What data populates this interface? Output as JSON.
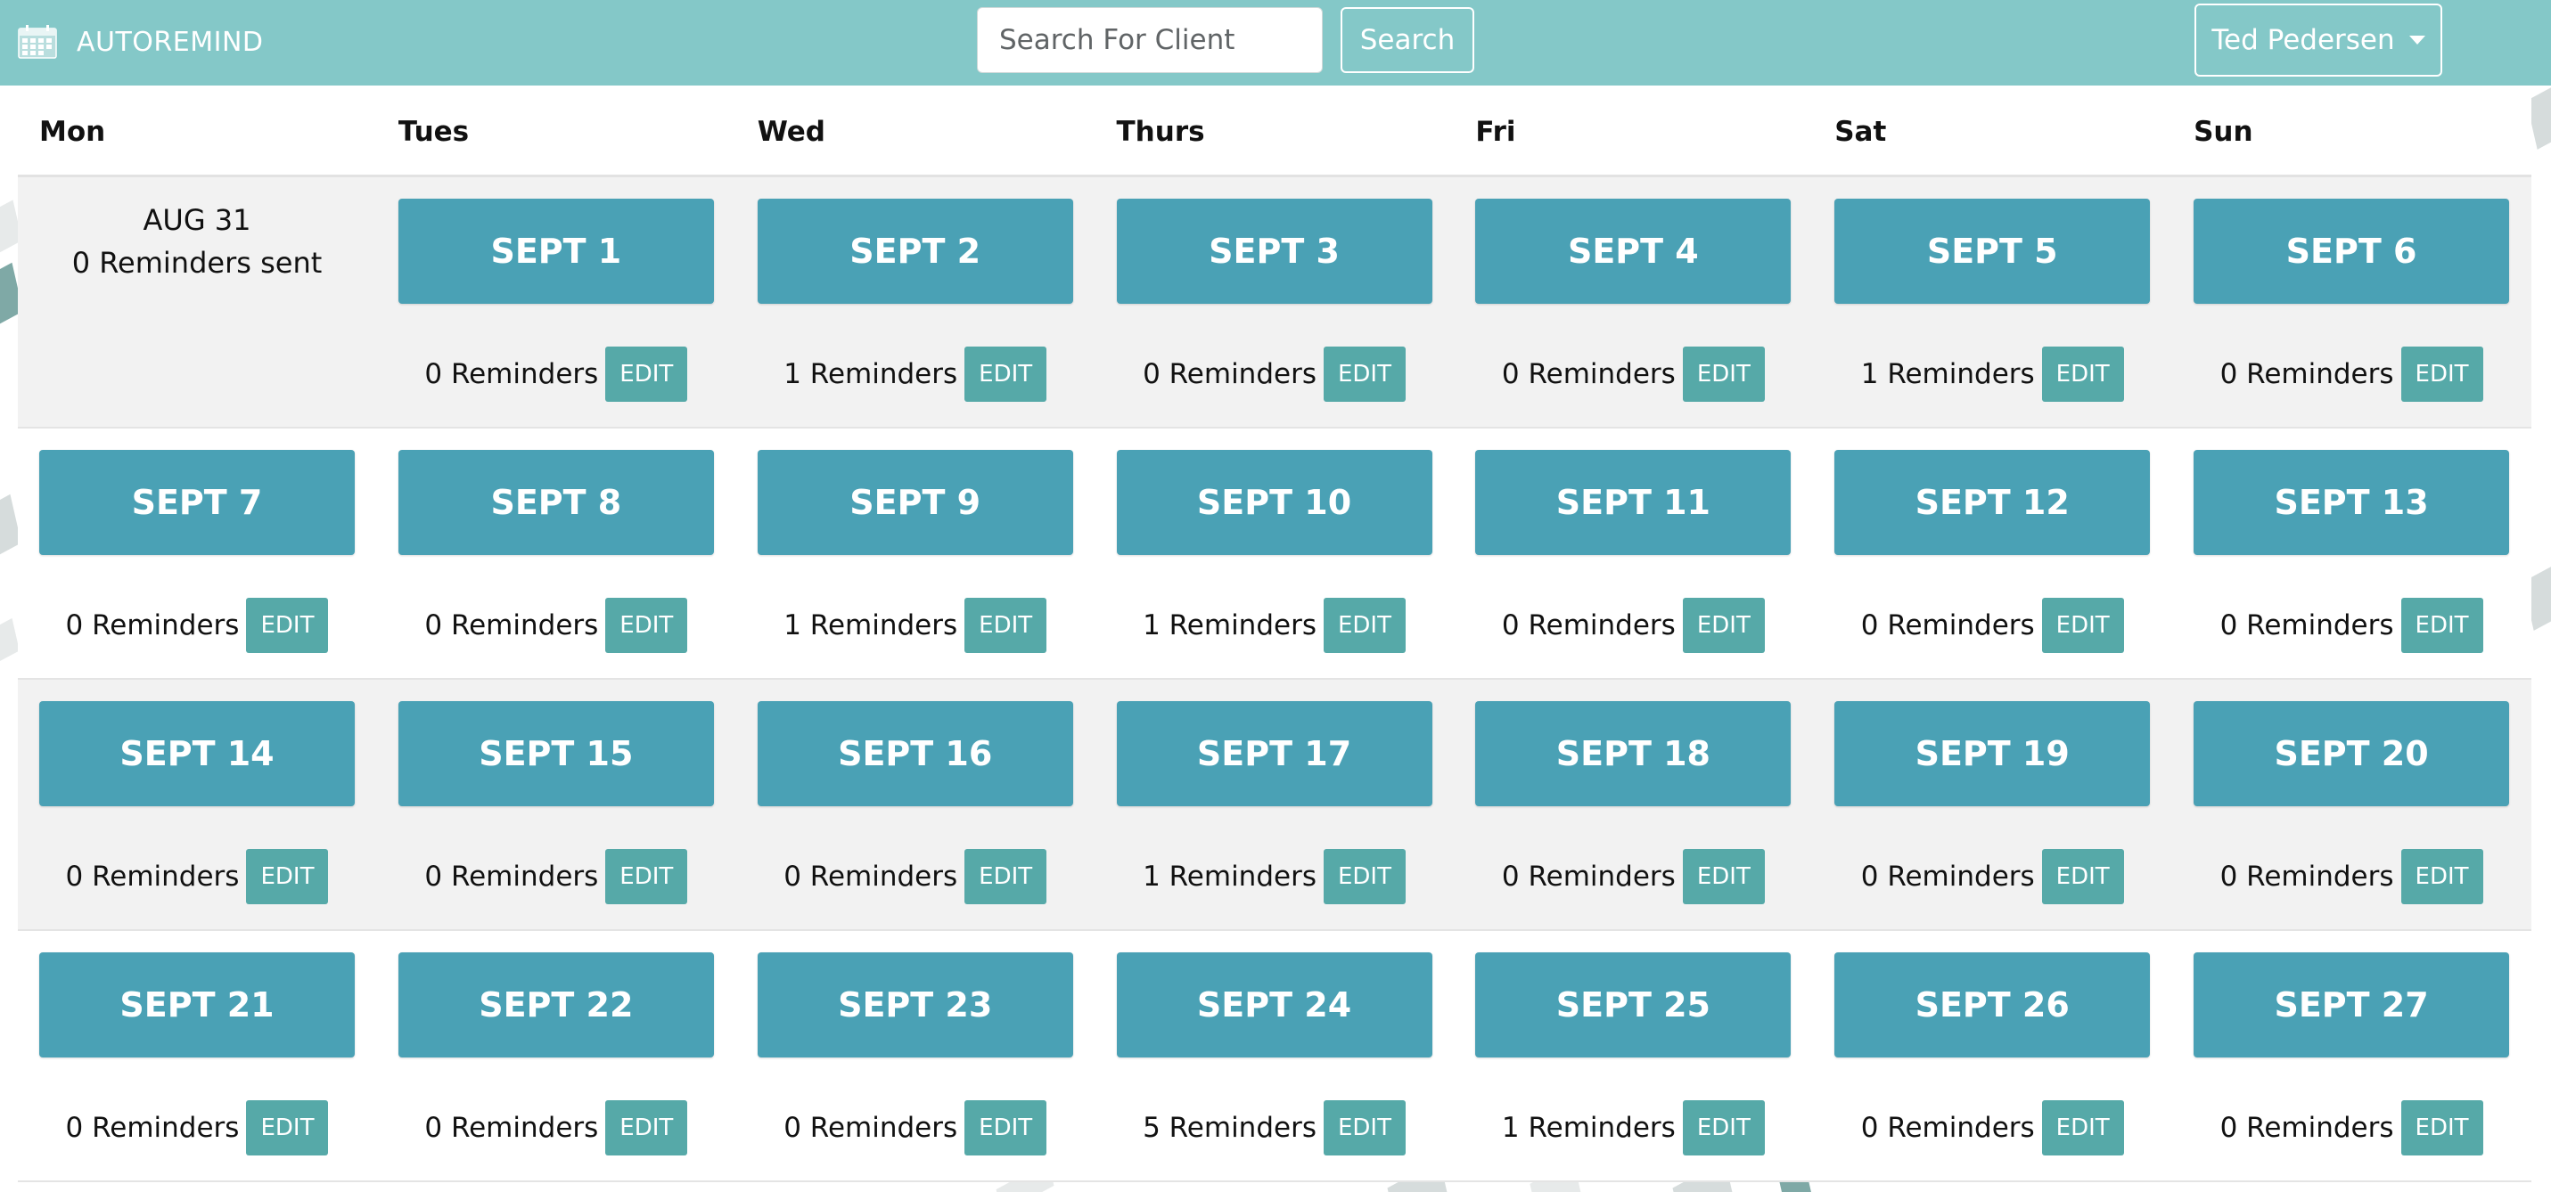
{
  "app": {
    "brand": "AUTOREMIND",
    "brand_icon": "calendar-icon"
  },
  "search": {
    "placeholder": "Search For Client",
    "button_label": "Search"
  },
  "user_menu": {
    "label": "Ted Pedersen",
    "icon": "chevron-down-icon"
  },
  "colors": {
    "topbar": "#84c8c8",
    "date_button": "#4aa1b5",
    "edit_button": "#56a9a8",
    "shaded_row": "#f2f2f2"
  },
  "calendar": {
    "day_headers": [
      "Mon",
      "Tues",
      "Wed",
      "Thurs",
      "Fri",
      "Sat",
      "Sun"
    ],
    "past_day": {
      "date": "AUG 31",
      "status": "0 Reminders sent"
    },
    "edit_label": "EDIT",
    "weeks": [
      {
        "days": [
          null,
          {
            "date": "SEPT 1",
            "reminders": "0 Reminders"
          },
          {
            "date": "SEPT 2",
            "reminders": "1 Reminders"
          },
          {
            "date": "SEPT 3",
            "reminders": "0 Reminders"
          },
          {
            "date": "SEPT 4",
            "reminders": "0 Reminders"
          },
          {
            "date": "SEPT 5",
            "reminders": "1 Reminders"
          },
          {
            "date": "SEPT 6",
            "reminders": "0 Reminders"
          }
        ]
      },
      {
        "days": [
          {
            "date": "SEPT 7",
            "reminders": "0 Reminders"
          },
          {
            "date": "SEPT 8",
            "reminders": "0 Reminders"
          },
          {
            "date": "SEPT 9",
            "reminders": "1 Reminders"
          },
          {
            "date": "SEPT 10",
            "reminders": "1 Reminders"
          },
          {
            "date": "SEPT 11",
            "reminders": "0 Reminders"
          },
          {
            "date": "SEPT 12",
            "reminders": "0 Reminders"
          },
          {
            "date": "SEPT 13",
            "reminders": "0 Reminders"
          }
        ]
      },
      {
        "days": [
          {
            "date": "SEPT 14",
            "reminders": "0 Reminders"
          },
          {
            "date": "SEPT 15",
            "reminders": "0 Reminders"
          },
          {
            "date": "SEPT 16",
            "reminders": "0 Reminders"
          },
          {
            "date": "SEPT 17",
            "reminders": "1 Reminders"
          },
          {
            "date": "SEPT 18",
            "reminders": "0 Reminders"
          },
          {
            "date": "SEPT 19",
            "reminders": "0 Reminders"
          },
          {
            "date": "SEPT 20",
            "reminders": "0 Reminders"
          }
        ]
      },
      {
        "days": [
          {
            "date": "SEPT 21",
            "reminders": "0 Reminders"
          },
          {
            "date": "SEPT 22",
            "reminders": "0 Reminders"
          },
          {
            "date": "SEPT 23",
            "reminders": "0 Reminders"
          },
          {
            "date": "SEPT 24",
            "reminders": "5 Reminders"
          },
          {
            "date": "SEPT 25",
            "reminders": "1 Reminders"
          },
          {
            "date": "SEPT 26",
            "reminders": "0 Reminders"
          },
          {
            "date": "SEPT 27",
            "reminders": "0 Reminders"
          }
        ]
      }
    ]
  }
}
